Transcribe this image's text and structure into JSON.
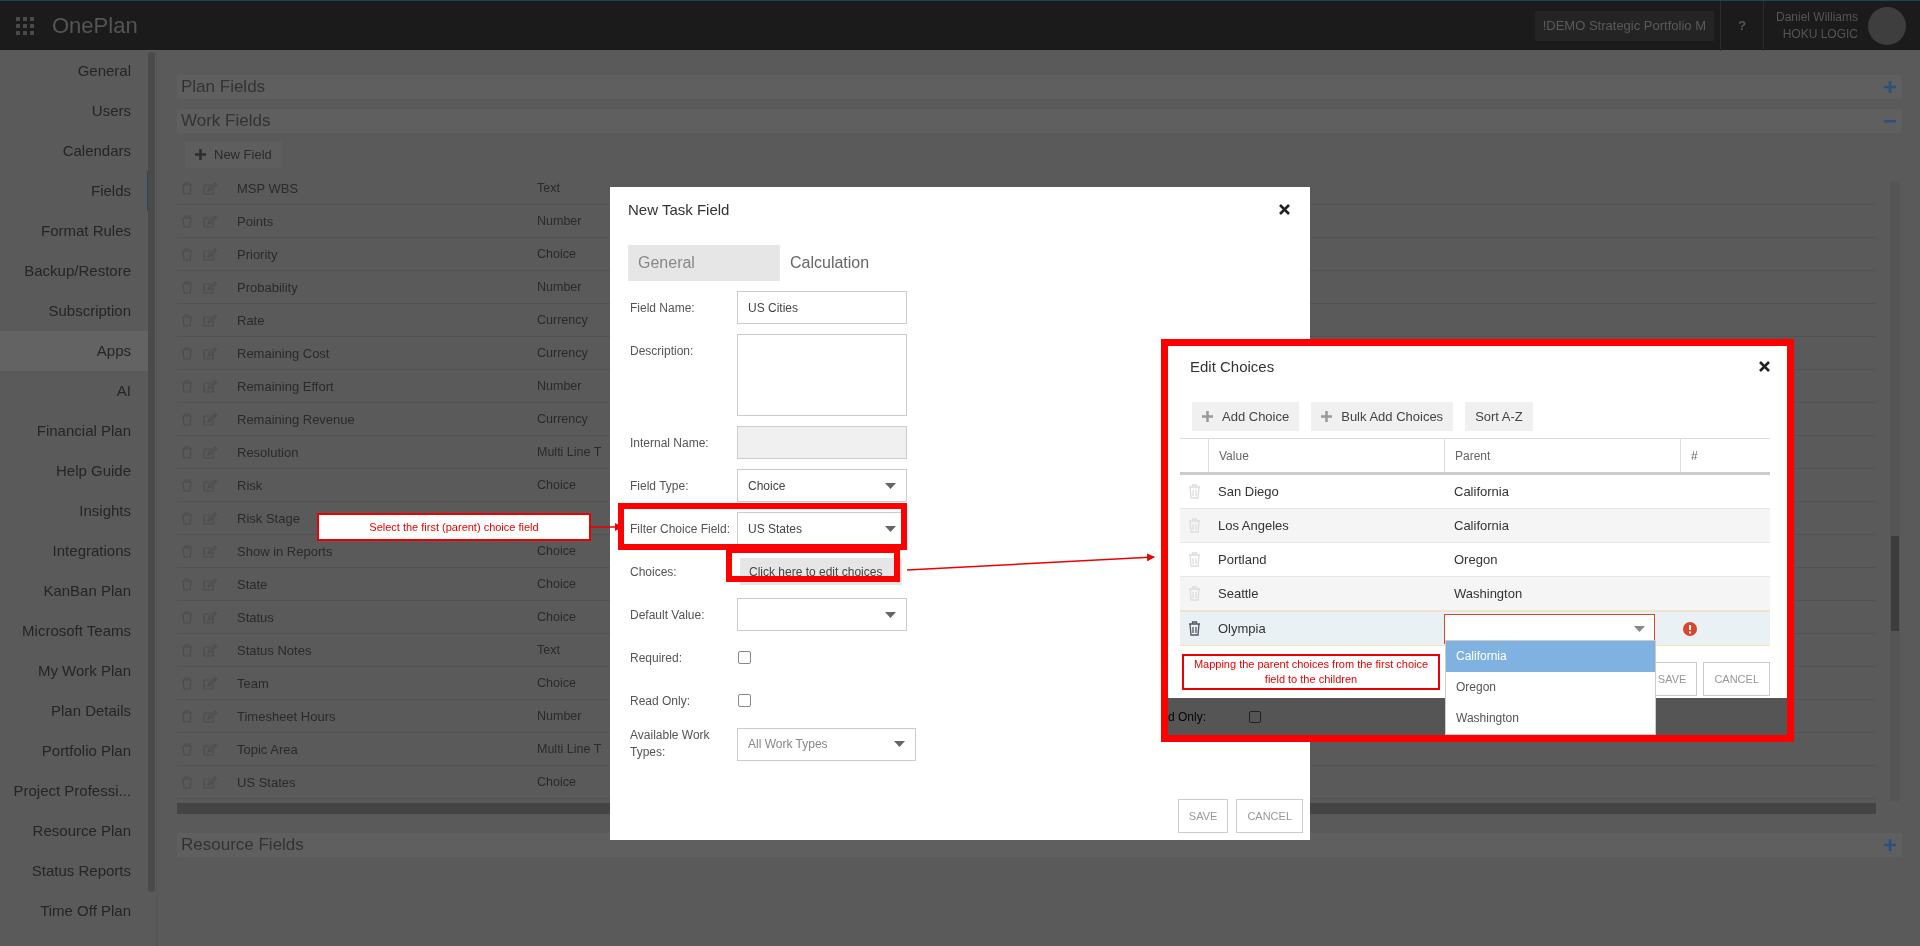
{
  "topbar": {
    "app_name": "OnePlan",
    "workspace": "!DEMO Strategic Portfolio M",
    "help": "?",
    "user_name": "Daniel Williams",
    "user_org": "HOKU LOGIC"
  },
  "sidebar": {
    "items": [
      {
        "label": "General",
        "selected": false,
        "kind": "item"
      },
      {
        "label": "Users",
        "selected": false,
        "kind": "item"
      },
      {
        "label": "Calendars",
        "selected": false,
        "kind": "item"
      },
      {
        "label": "Fields",
        "selected": true,
        "kind": "item"
      },
      {
        "label": "Format Rules",
        "selected": false,
        "kind": "item"
      },
      {
        "label": "Backup/Restore",
        "selected": false,
        "kind": "item"
      },
      {
        "label": "Subscription",
        "selected": false,
        "kind": "item"
      },
      {
        "label": "Apps",
        "selected": false,
        "kind": "group"
      },
      {
        "label": "AI",
        "selected": false,
        "kind": "item"
      },
      {
        "label": "Financial Plan",
        "selected": false,
        "kind": "item"
      },
      {
        "label": "Help Guide",
        "selected": false,
        "kind": "item"
      },
      {
        "label": "Insights",
        "selected": false,
        "kind": "item"
      },
      {
        "label": "Integrations",
        "selected": false,
        "kind": "item"
      },
      {
        "label": "KanBan Plan",
        "selected": false,
        "kind": "item"
      },
      {
        "label": "Microsoft Teams",
        "selected": false,
        "kind": "item"
      },
      {
        "label": "My Work Plan",
        "selected": false,
        "kind": "item"
      },
      {
        "label": "Plan Details",
        "selected": false,
        "kind": "item"
      },
      {
        "label": "Portfolio Plan",
        "selected": false,
        "kind": "item"
      },
      {
        "label": "Project Professi...",
        "selected": false,
        "kind": "item"
      },
      {
        "label": "Resource Plan",
        "selected": false,
        "kind": "item"
      },
      {
        "label": "Status Reports",
        "selected": false,
        "kind": "item"
      },
      {
        "label": "Time Off Plan",
        "selected": false,
        "kind": "item"
      }
    ]
  },
  "plan_fields": {
    "title": "Plan Fields",
    "expanded": false
  },
  "work_fields": {
    "title": "Work Fields",
    "expanded": true,
    "new_field_button": "New Field",
    "rows": [
      {
        "name": "MSP WBS",
        "type": "Text"
      },
      {
        "name": "Points",
        "type": "Number"
      },
      {
        "name": "Priority",
        "type": "Choice"
      },
      {
        "name": "Probability",
        "type": "Number"
      },
      {
        "name": "Rate",
        "type": "Currency"
      },
      {
        "name": "Remaining Cost",
        "type": "Currency"
      },
      {
        "name": "Remaining Effort",
        "type": "Number"
      },
      {
        "name": "Remaining Revenue",
        "type": "Currency"
      },
      {
        "name": "Resolution",
        "type": "Multi Line T"
      },
      {
        "name": "Risk",
        "type": "Choice"
      },
      {
        "name": "Risk Stage"
      },
      {
        "name": "Show in Reports",
        "type": "Choice"
      },
      {
        "name": "State",
        "type": "Choice"
      },
      {
        "name": "Status",
        "type": "Choice"
      },
      {
        "name": "Status Notes",
        "type": "Text"
      },
      {
        "name": "Team",
        "type": "Choice"
      },
      {
        "name": "Timesheet Hours",
        "type": "Number"
      },
      {
        "name": "Topic Area",
        "type": "Multi Line T"
      },
      {
        "name": "US States",
        "type": "Choice"
      }
    ]
  },
  "resource_fields": {
    "title": "Resource Fields",
    "expanded": false
  },
  "new_task_field": {
    "title": "New Task Field",
    "tabs": [
      {
        "label": "General",
        "selected": true
      },
      {
        "label": "Calculation",
        "selected": false
      }
    ],
    "fields": [
      {
        "label": "Field Name:",
        "kind": "text",
        "value": "US Cities",
        "highlighted": false
      },
      {
        "label": "Description:",
        "kind": "textarea",
        "highlighted": false
      },
      {
        "label": "Internal Name:",
        "kind": "readonly",
        "highlighted": false
      },
      {
        "label": "Field Type:",
        "kind": "select",
        "value": "Choice",
        "highlighted": false
      },
      {
        "label": "Filter Choice Field:",
        "kind": "select",
        "value": "US States",
        "highlighted": true
      },
      {
        "label": "Choices:",
        "kind": "button",
        "value": "Click here to edit choices",
        "highlighted": true
      },
      {
        "label": "Default Value:",
        "kind": "select",
        "highlighted": false
      },
      {
        "label": "Required:",
        "kind": "checkbox",
        "checked": false,
        "highlighted": false
      },
      {
        "label": "Read Only:",
        "kind": "checkbox",
        "checked": false,
        "highlighted": false
      },
      {
        "label": "Available Work Types:",
        "kind": "wideselect",
        "placeholder": "All Work Types",
        "highlighted": false
      }
    ],
    "buttons": [
      "SAVE",
      "CANCEL"
    ]
  },
  "edit_choices": {
    "title": "Edit Choices",
    "highlighted": true,
    "toolbar": [
      {
        "label": "Add Choice",
        "kind": "add"
      },
      {
        "label": "Bulk Add Choices",
        "kind": "add"
      },
      {
        "label": "Sort A-Z",
        "kind": "plain"
      }
    ],
    "columns": [
      "Value",
      "Parent",
      "#"
    ],
    "rows": [
      {
        "value": "San Diego",
        "parent": "California",
        "selected": false,
        "editing": false
      },
      {
        "value": "Los Angeles",
        "parent": "California",
        "selected": false,
        "editing": false
      },
      {
        "value": "Portland",
        "parent": "Oregon",
        "selected": false,
        "editing": false
      },
      {
        "value": "Seattle",
        "parent": "Washington",
        "selected": false,
        "editing": false
      },
      {
        "value": "Olympia",
        "selected": true,
        "editing": true,
        "error": true,
        "options": [
          {
            "label": "California",
            "selected": true
          },
          {
            "label": "Oregon",
            "selected": false
          },
          {
            "label": "Washington",
            "selected": false
          }
        ]
      }
    ],
    "buttons": [
      "SAVE",
      "CANCEL"
    ],
    "behind": {
      "label": "d Only:",
      "checked": false
    }
  },
  "annotations": [
    {
      "text": "Select the first (parent) choice field",
      "kind": "left"
    },
    {
      "text": "Mapping the parent choices from the first choice field to the children",
      "kind": "bottom"
    }
  ]
}
